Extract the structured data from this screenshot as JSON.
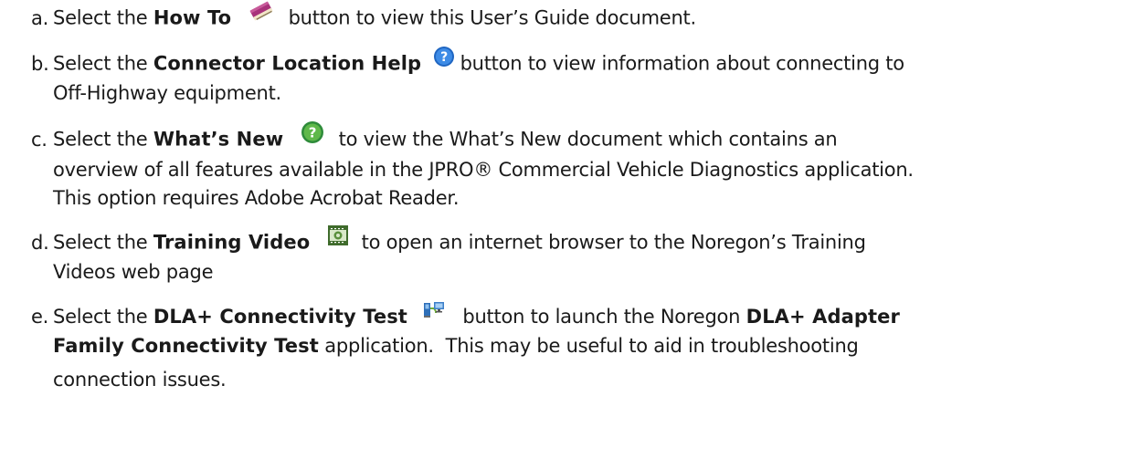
{
  "items": [
    {
      "marker": "a.",
      "pre": "Select the ",
      "bold": "How To",
      "icon": "book-icon",
      "post": "button to view this User’s Guide document."
    },
    {
      "marker": "b.",
      "pre": "Select the ",
      "bold": "Connector Location Help",
      "icon": "help-circle-icon",
      "post": "button to view information about connecting to",
      "line2": "Off-Highway equipment."
    },
    {
      "marker": "c.",
      "pre": "Select the ",
      "bold": "What’s New",
      "icon": "whats-new-icon",
      "post": "to view the What’s New document which contains an",
      "line2": "overview of all features available in the JPRO® Commercial Vehicle Diagnostics application.",
      "line3": "This option requires Adobe Acrobat Reader."
    },
    {
      "marker": "d.",
      "pre": "Select the ",
      "bold": "Training Video",
      "icon": "film-icon",
      "post": "to open an internet browser to the Noregon’s Training",
      "line2": "Videos web page"
    },
    {
      "marker": "e.",
      "pre": "Select the ",
      "bold": "DLA+ Connectivity Test",
      "icon": "connectivity-icon",
      "post": "button to launch the Noregon ",
      "bold2": "DLA+ Adapter",
      "line2_bold": "Family Connectivity Test",
      "line2": " application.  This may be useful to aid in troubleshooting",
      "line3": "connection issues."
    }
  ]
}
